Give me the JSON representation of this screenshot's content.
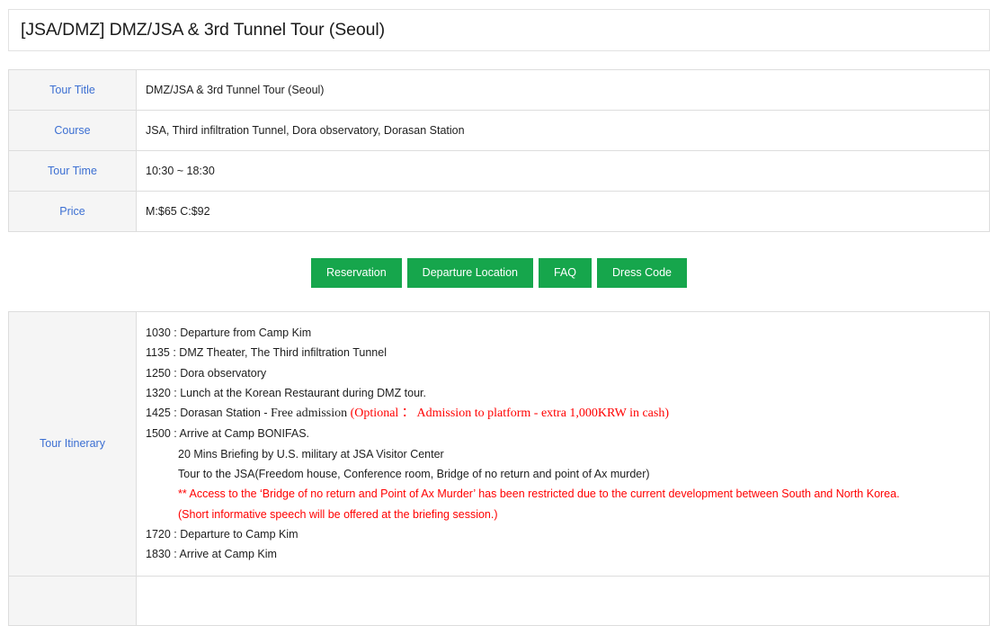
{
  "header": {
    "title": "[JSA/DMZ] DMZ/JSA & 3rd Tunnel Tour (Seoul)"
  },
  "info_table": {
    "rows": [
      {
        "label": "Tour Title",
        "value": "DMZ/JSA & 3rd Tunnel Tour (Seoul)"
      },
      {
        "label": "Course",
        "value": "JSA, Third infiltration Tunnel, Dora observatory, Dorasan Station"
      },
      {
        "label": "Tour Time",
        "value": "10:30 ~ 18:30"
      },
      {
        "label": "Price",
        "value": "M:$65 C:$92"
      }
    ]
  },
  "buttons": {
    "accent_color": "#16a64c",
    "items": [
      {
        "label": "Reservation"
      },
      {
        "label": "Departure Location"
      },
      {
        "label": "FAQ"
      },
      {
        "label": "Dress Code"
      }
    ]
  },
  "itinerary": {
    "label": "Tour Itinerary",
    "lines": [
      {
        "text": "1030 : Departure from Camp Kim"
      },
      {
        "text": "1135 : DMZ Theater, The Third infiltration Tunnel"
      },
      {
        "text": "1250 : Dora observatory"
      },
      {
        "text": "1320 : Lunch at the Korean Restaurant during DMZ tour."
      },
      {
        "prefix": "1425 : Dorasan Station - ",
        "serif_black": "Free admission",
        "serif_red": "(Optional ： Admission to platform - extra 1,000KRW in cash)"
      },
      {
        "text": "1500 : Arrive at Camp BONIFAS."
      },
      {
        "text": "20 Mins Briefing by U.S. military at JSA Visitor Center",
        "indent": true
      },
      {
        "text": "Tour to the JSA(Freedom house, Conference room, Bridge of no return and point of Ax murder)",
        "indent": true
      },
      {
        "text": "** Access to the ‘Bridge of no return and Point of Ax Murder’ has been restricted due to the current development between South and North Korea.",
        "indent": true,
        "red": true
      },
      {
        "text": "(Short informative speech will be offered at the briefing session.)",
        "indent": true,
        "red": true
      },
      {
        "text": "1720 : Departure to Camp Kim"
      },
      {
        "text": "1830 : Arrive at Camp Kim"
      }
    ]
  },
  "colors": {
    "label_blue": "#3c6fd2",
    "accent_green": "#16a64c",
    "alert_red": "#ff0000",
    "border_gray": "#dddddd",
    "cell_bg": "#f5f5f5"
  }
}
